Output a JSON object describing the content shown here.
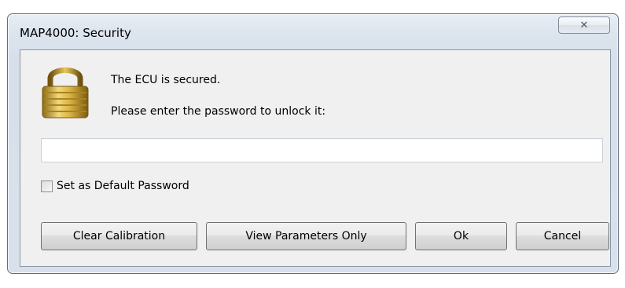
{
  "window": {
    "title": "MAP4000: Security",
    "close_glyph": "✕"
  },
  "dialog": {
    "lock_icon": "lock-icon",
    "message_line1": "The ECU is secured.",
    "message_line2": "Please enter the password to unlock it:",
    "password_value": "",
    "checkbox_label": "Set as Default Password",
    "checkbox_checked": false
  },
  "buttons": {
    "clear_calibration": "Clear Calibration",
    "view_parameters_only": "View Parameters Only",
    "ok": "Ok",
    "cancel": "Cancel"
  },
  "colors": {
    "frame": "#d7e0ea",
    "client": "#f0f0f0",
    "lock_gold": "#c9a227"
  }
}
